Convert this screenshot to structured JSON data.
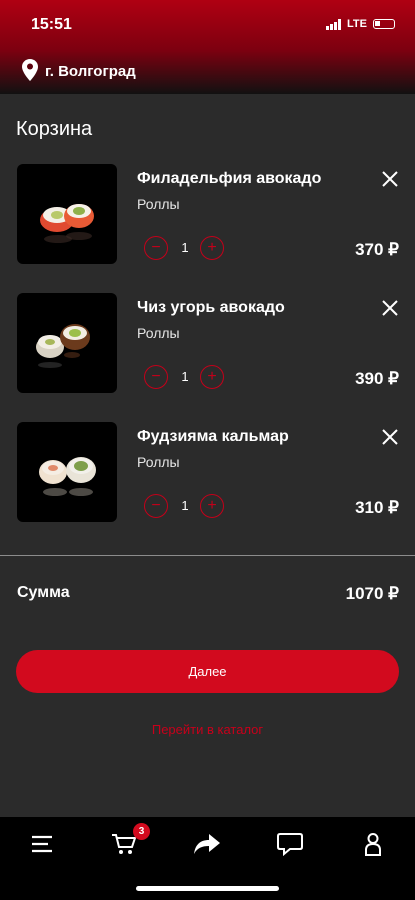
{
  "status": {
    "time": "15:51",
    "network": "LTE"
  },
  "location": {
    "city": "г. Волгоград"
  },
  "cart": {
    "title": "Корзина",
    "items": [
      {
        "name": "Филадельфия авокадо",
        "category": "Роллы",
        "quantity": "1",
        "price": "370 ₽"
      },
      {
        "name": "Чиз угорь авокадо",
        "category": "Роллы",
        "quantity": "1",
        "price": "390 ₽"
      },
      {
        "name": "Фудзияма кальмар",
        "category": "Роллы",
        "quantity": "1",
        "price": "310 ₽"
      }
    ],
    "sum_label": "Сумма",
    "sum_value": "1070 ₽",
    "next_label": "Далее",
    "catalog_link": "Перейти в каталог"
  },
  "tabbar": {
    "items": [
      "menu-icon",
      "cart-icon",
      "share-icon",
      "chat-icon",
      "profile-icon"
    ],
    "cart_badge": "3"
  },
  "colors": {
    "accent": "#d20a1e",
    "background": "#2b2b2b",
    "header": "#8b0012"
  }
}
